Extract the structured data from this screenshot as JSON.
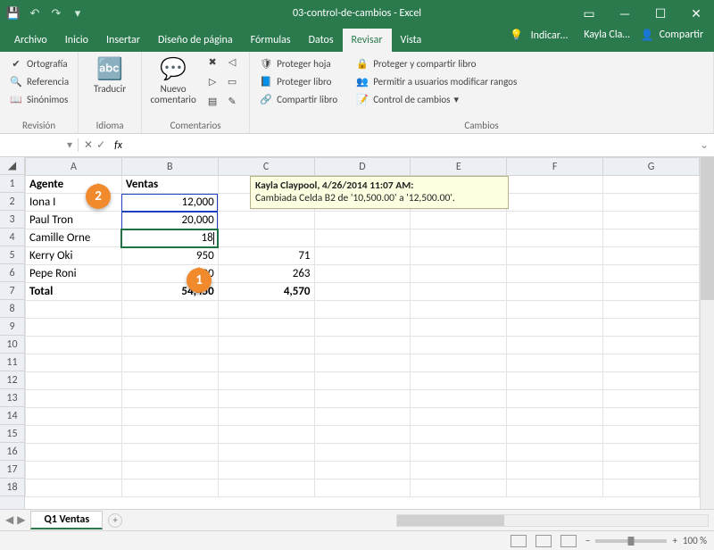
{
  "title": "03-control-de-cambios - Excel",
  "tabs": [
    "Archivo",
    "Inicio",
    "Insertar",
    "Diseño de página",
    "Fórmulas",
    "Datos",
    "Revisar",
    "Vista"
  ],
  "active_tab": "Revisar",
  "tellme": "Indicar…",
  "user": "Kayla Cla…",
  "share": "Compartir",
  "ribbon": {
    "g1": {
      "label": "Revisión",
      "items": [
        "Ortografía",
        "Referencia",
        "Sinónimos"
      ]
    },
    "g2": {
      "label": "Idioma",
      "btn": "Traducir"
    },
    "g3": {
      "label": "Comentarios",
      "btn": "Nuevo comentario"
    },
    "g4": {
      "label": "Cambios",
      "items": [
        "Proteger hoja",
        "Proteger libro",
        "Compartir libro",
        "Proteger y compartir libro",
        "Permitir a usuarios modificar rangos",
        "Control de cambios"
      ]
    }
  },
  "namebox": "",
  "formula": "",
  "columns": [
    "A",
    "B",
    "C",
    "D",
    "E",
    "F",
    "G"
  ],
  "rows_count": 18,
  "header": {
    "A": "Agente",
    "B": "Ventas"
  },
  "data_rows": [
    {
      "A": "Iona I",
      "B": "12,000",
      "C": ""
    },
    {
      "A": "Paul Tron",
      "B": "20,000",
      "C": ""
    },
    {
      "A": "Camille  Orne",
      "B": "18",
      "C": ""
    },
    {
      "A": "Kerry Oki",
      "B": "950",
      "C": "71"
    },
    {
      "A": "Pepe Roni",
      "B": "500",
      "C": "263"
    }
  ],
  "total_row": {
    "A": "Total",
    "B": "54,450",
    "C": "4,570"
  },
  "tooltip_author": "Kayla Claypool, 4/26/2014 11:07 AM:",
  "tooltip_body": "Cambiada Celda B2 de '10,500.00' a '12,500.00'.",
  "sheet_tab": "Q1 Ventas",
  "zoom": "100 %"
}
